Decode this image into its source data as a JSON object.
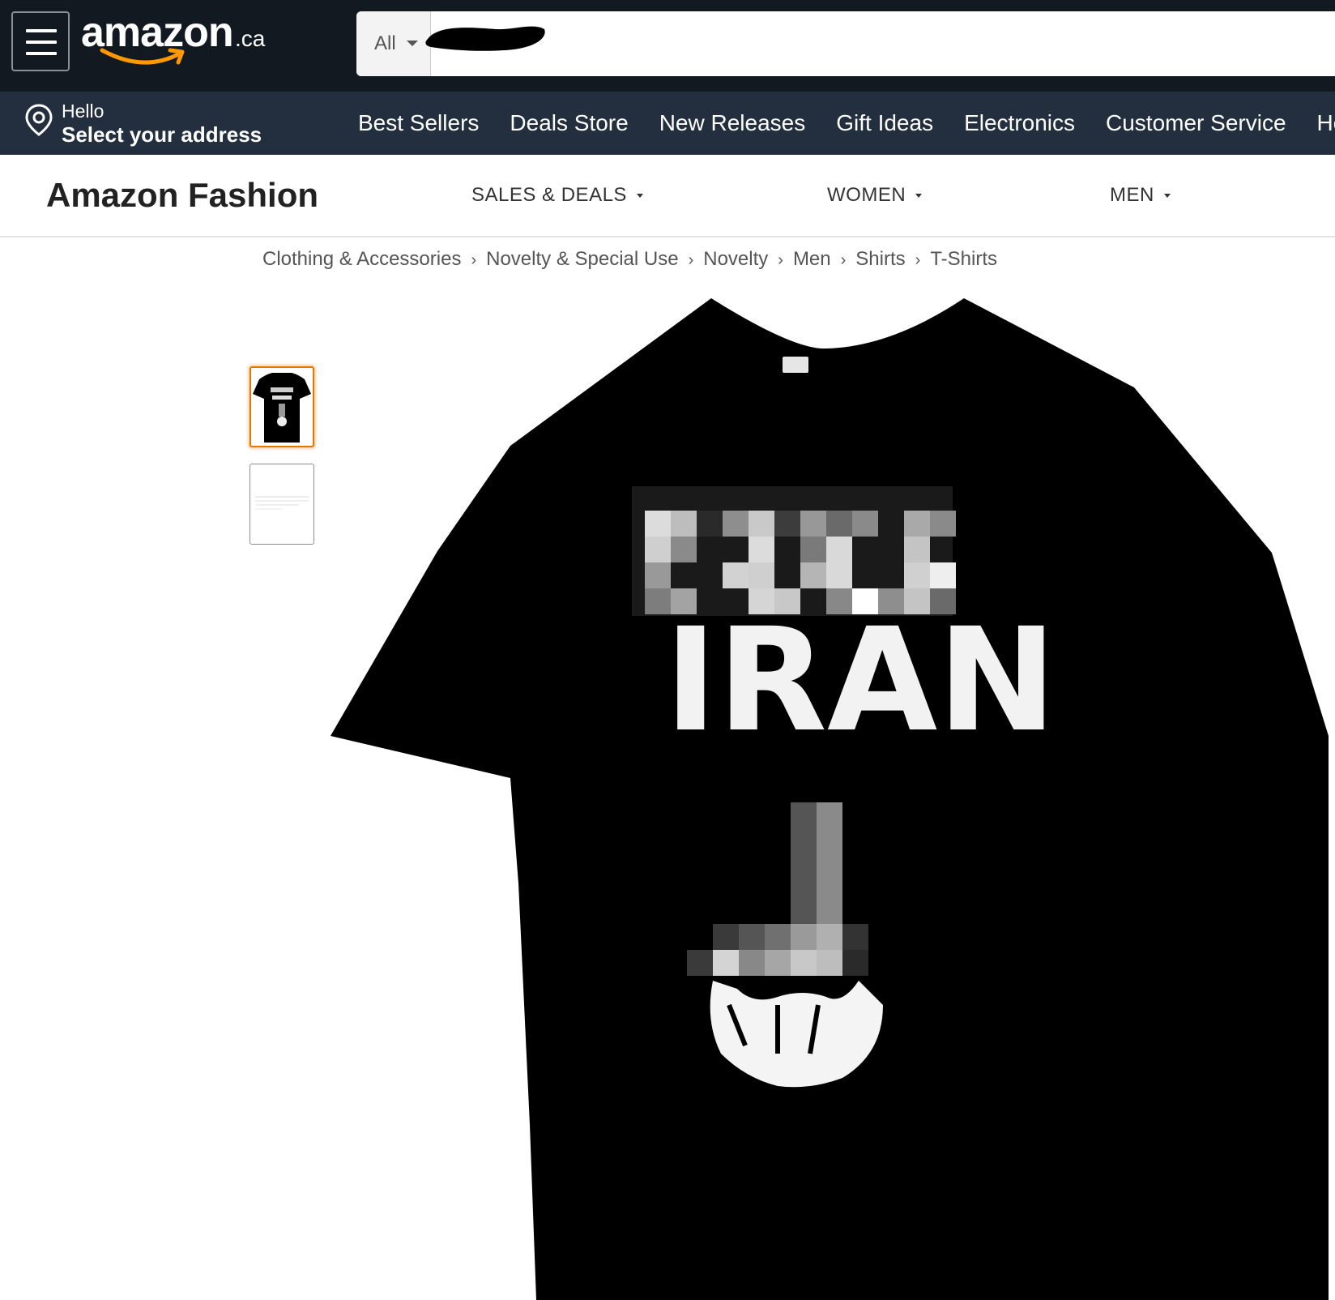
{
  "header": {
    "logo_text": "amazon",
    "logo_tld": ".ca",
    "search": {
      "category": "All",
      "value": ""
    }
  },
  "address": {
    "greeting": "Hello",
    "prompt": "Select your address"
  },
  "nav": {
    "links": [
      "Best Sellers",
      "Deals Store",
      "New Releases",
      "Gift Ideas",
      "Electronics",
      "Customer Service",
      "He"
    ]
  },
  "fashion": {
    "title": "Amazon Fashion",
    "menu": [
      "SALES & DEALS",
      "WOMEN",
      "MEN"
    ]
  },
  "breadcrumb": [
    "Clothing & Accessories",
    "Novelty & Special Use",
    "Novelty",
    "Men",
    "Shirts",
    "T-Shirts"
  ],
  "product": {
    "shirt_text": "IRAN",
    "thumbnail_selected": 1,
    "thumbnail_count": 2
  },
  "colors": {
    "topbar": "#131921",
    "navbar": "#232f3e",
    "accent_orange": "#ff9900",
    "thumb_selected_border": "#e77600"
  }
}
